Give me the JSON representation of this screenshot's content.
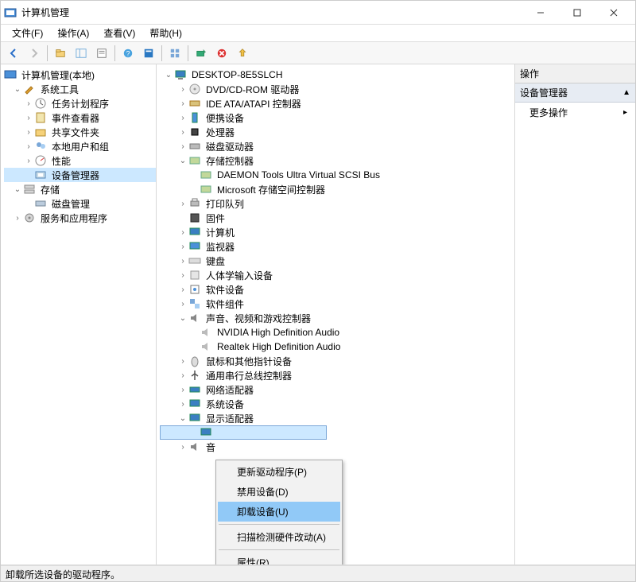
{
  "titlebar": {
    "title": "计算机管理"
  },
  "menubar": {
    "file": "文件(F)",
    "action": "操作(A)",
    "view": "查看(V)",
    "help": "帮助(H)"
  },
  "left_tree": {
    "root": "计算机管理(本地)",
    "system_tools": "系统工具",
    "task_scheduler": "任务计划程序",
    "event_viewer": "事件查看器",
    "shared_folders": "共享文件夹",
    "local_users_groups": "本地用户和组",
    "performance": "性能",
    "device_manager": "设备管理器",
    "storage": "存储",
    "disk_management": "磁盘管理",
    "services_apps": "服务和应用程序"
  },
  "mid_tree": {
    "root": "DESKTOP-8E5SLCH",
    "dvd": "DVD/CD-ROM 驱动器",
    "ide": "IDE ATA/ATAPI 控制器",
    "portable": "便携设备",
    "processors": "处理器",
    "disk_drives": "磁盘驱动器",
    "storage_controllers": "存储控制器",
    "sc_daemon": "DAEMON Tools Ultra Virtual SCSI Bus",
    "sc_msft": "Microsoft 存储空间控制器",
    "print_queues": "打印队列",
    "firmware": "固件",
    "computer": "计算机",
    "monitors": "监视器",
    "keyboards": "键盘",
    "hid": "人体学输入设备",
    "software_devices": "软件设备",
    "software_components": "软件组件",
    "sound": "声音、视频和游戏控制器",
    "nvidia_audio": "NVIDIA High Definition Audio",
    "realtek_audio": "Realtek High Definition Audio",
    "mice": "鼠标和其他指针设备",
    "usb": "通用串行总线控制器",
    "network": "网络适配器",
    "system_devices": "系统设备",
    "display_adapters": "显示适配器",
    "audio_io": "音"
  },
  "context_menu": {
    "update_driver": "更新驱动程序(P)",
    "disable_device": "禁用设备(D)",
    "uninstall_device": "卸载设备(U)",
    "scan_hardware": "扫描检测硬件改动(A)",
    "properties": "属性(R)"
  },
  "actions": {
    "header": "操作",
    "section": "设备管理器",
    "more": "更多操作"
  },
  "statusbar": {
    "text": "卸载所选设备的驱动程序。"
  }
}
